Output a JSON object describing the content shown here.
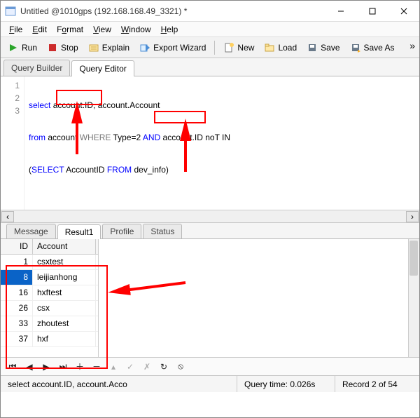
{
  "title": "Untitled @1010gps (192.168.168.49_3321) *",
  "menu": {
    "file": "File",
    "edit": "Edit",
    "format": "Format",
    "view": "View",
    "window": "Window",
    "help": "Help"
  },
  "toolbar": {
    "run": "Run",
    "stop": "Stop",
    "explain": "Explain",
    "export": "Export Wizard",
    "new": "New",
    "load": "Load",
    "save": "Save",
    "saveas": "Save As"
  },
  "queryTabs": {
    "builder": "Query Builder",
    "editor": "Query Editor"
  },
  "editor": {
    "lines": [
      "1",
      "2",
      "3"
    ],
    "l1_select": "select",
    "l1_rest": " account.ID, account.Account",
    "l2_from": "from",
    "l2_acc": " account ",
    "l2_where": "WHERE",
    "l2_mid": " Type=2 ",
    "l2_and": "AND",
    "l2_rest": " account.ID noT IN",
    "l3_open": "(",
    "l3_select": "SELECT",
    "l3_mid": " AccountID ",
    "l3_from": "FROM",
    "l3_tbl": " dev_info",
    "l3_close": ")"
  },
  "resultTabs": {
    "message": "Message",
    "result": "Result1",
    "profile": "Profile",
    "status": "Status"
  },
  "grid": {
    "cols": {
      "id": "ID",
      "acc": "Account"
    },
    "rows": [
      {
        "id": "1",
        "acc": "csxtest"
      },
      {
        "id": "8",
        "acc": "leijianhong"
      },
      {
        "id": "16",
        "acc": "hxftest"
      },
      {
        "id": "26",
        "acc": "csx"
      },
      {
        "id": "33",
        "acc": "zhoutest"
      },
      {
        "id": "37",
        "acc": "hxf"
      }
    ]
  },
  "status": {
    "sql": "select account.ID, account.Acco",
    "qtime": "Query time: 0.026s",
    "rec": "Record 2 of 54"
  }
}
